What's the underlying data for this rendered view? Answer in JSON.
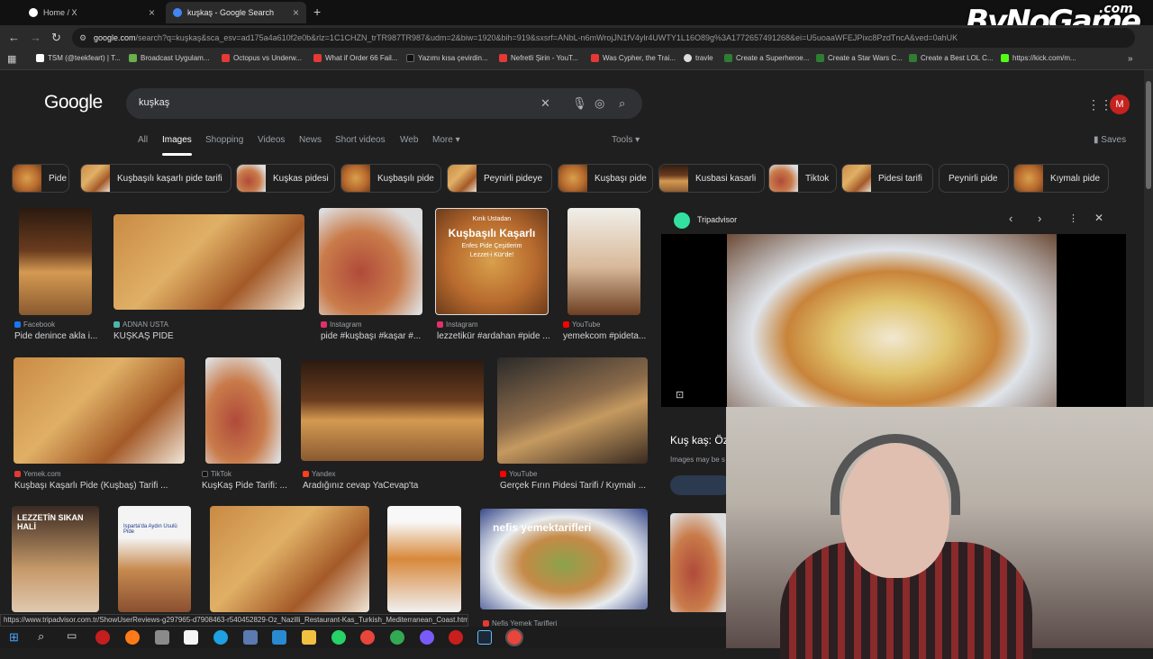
{
  "tabs": [
    {
      "title": "Home / X",
      "active": false
    },
    {
      "title": "kuşkaş - Google Search",
      "active": true
    }
  ],
  "new_tab": "+",
  "url": {
    "host": "google.com",
    "rest": "/search?q=kuşkaş&sca_esv=ad175a4a610f2e0b&rlz=1C1CHZN_trTR987TR987&udm=2&biw=1920&bih=919&sxsrf=ANbL-n6mWrojJN1fV4ylr4UWTY1L16O89g%3A1772657491268&ei=U5uoaaWFEJPixc8PzdTncA&ved=0ahUK"
  },
  "bookmarks": [
    {
      "label": "TSM (@teekfeart) | T...",
      "color": "#ffffff"
    },
    {
      "label": "Broadcast Uygulam...",
      "color": "#6ab04c"
    },
    {
      "label": "Octopus vs Underw...",
      "color": "#e53935"
    },
    {
      "label": "What if Order 66 Fail...",
      "color": "#e53935"
    },
    {
      "label": "Yazımı kısa çevirdin...",
      "color": "#111111"
    },
    {
      "label": "Nefretli Şirin - YouT...",
      "color": "#e53935"
    },
    {
      "label": "Was Cypher, the Trai...",
      "color": "#e53935"
    },
    {
      "label": "travle",
      "color": "#dddddd"
    },
    {
      "label": "Create a Superheroe...",
      "color": "#2e7d32"
    },
    {
      "label": "Create a Star Wars C...",
      "color": "#2e7d32"
    },
    {
      "label": "Create a Best LOL C...",
      "color": "#2e7d32"
    },
    {
      "label": "https://kick.com/m...",
      "color": "#53fc18"
    }
  ],
  "logo": "Google",
  "search": {
    "query": "kuşkaş"
  },
  "nav_tabs": [
    "All",
    "Images",
    "Shopping",
    "Videos",
    "News",
    "Short videos",
    "Web",
    "More"
  ],
  "active_nav": "Images",
  "tools": "Tools",
  "saves": "Saves",
  "avatar_letter": "M",
  "chips": [
    "Pide",
    "Kuşbaşılı kaşarlı pide tarifi",
    "Kuşkas pidesi",
    "Kuşbaşılı pide",
    "Peynirli pideye",
    "Kuşbaşı pide",
    "Kusbasi kasarli",
    "Tiktok",
    "Pidesi tarifi",
    "Peynirli pide",
    "Kıymalı pide"
  ],
  "results_row1": [
    {
      "source": "Facebook",
      "caption": "Pide denince akla i...",
      "color": "#1877f2"
    },
    {
      "source": "ADNAN USTA",
      "caption": "KUŞKAŞ PİDE",
      "color": "#4db6ac"
    },
    {
      "source": "Instagram",
      "caption": "pide #kuşbaşı #kaşar #...",
      "color": "#e1306c"
    },
    {
      "source": "Instagram",
      "caption": "lezzetikür #ardahan #pide ...",
      "color": "#e1306c"
    },
    {
      "source": "YouTube",
      "caption": "yemekcom #pideta...",
      "color": "#ff0000"
    }
  ],
  "results_row2": [
    {
      "source": "Yemek.com",
      "caption": "Kuşbaşı Kaşarlı Pide (Kuşbaş) Tarifi ...",
      "color": "#e53935"
    },
    {
      "source": "TikTok",
      "caption": "KuşKaş Pide Tarifi: ...",
      "color": "#111111"
    },
    {
      "source": "Yandex",
      "caption": "Aradığınız cevap YaCevap'ta",
      "color": "#fc3f1d"
    },
    {
      "source": "YouTube",
      "caption": "Gerçek Fırın Pidesi Tarifi / Kıymalı ...",
      "color": "#ff0000"
    }
  ],
  "results_row3_source": "Nefis Yemek Tarifleri",
  "row3_overlays": [
    "LEZZETİN SIKAN HALİ",
    "Isparta'da Aydın Usulü Pide",
    "nefis yemektarifleri"
  ],
  "thumb_text": {
    "title": "Kuşbaşılı Kaşarlı",
    "sub": "Enfes Pide Çeşitlerim",
    "sub2": "Lezzet-i Kür'de!",
    "top": "Kırık Ustadan"
  },
  "panel": {
    "source": "Tripadvisor",
    "title": "Kuş kaş: Öz",
    "note": "Images may be s"
  },
  "status_url": "https://www.tripadvisor.com.tr/ShowUserReviews-g297965-d7908463-r540452829-Oz_Nazilli_Restaurant-Kas_Turkish_Mediterranean_Coast.html",
  "watermark": {
    "main": "ByNoGame",
    "tld": ".com"
  },
  "icons": {
    "back": "back-icon",
    "forward": "forward-icon",
    "reload": "reload-icon",
    "clear": "close-icon",
    "mic": "mic-icon",
    "lens": "camera-lens-icon",
    "search": "search-icon",
    "apps": "apps-grid-icon",
    "bookmark": "bookmark-icon"
  }
}
